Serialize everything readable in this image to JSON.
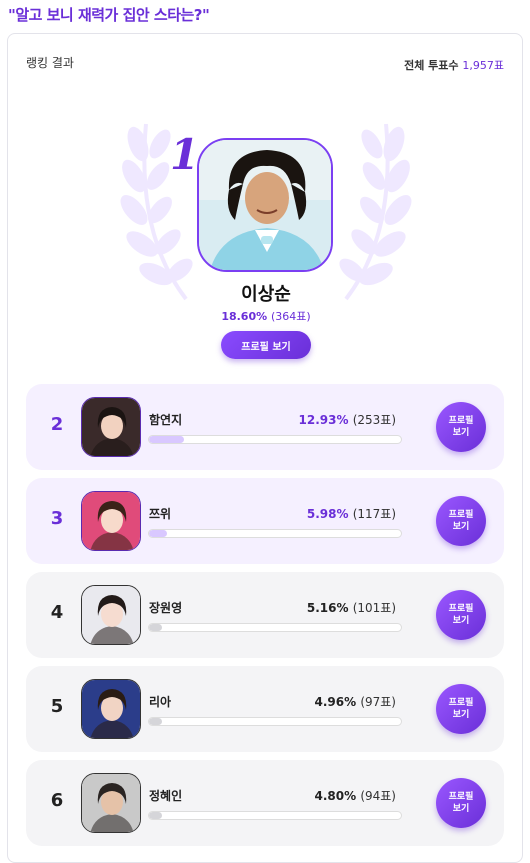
{
  "heading": "\"알고 보니 재력가 집안 스타는?\"",
  "card": {
    "title": "랭킹 결과",
    "total_label": "전체 투표수",
    "total_value": "1,957표"
  },
  "winner": {
    "rank": "1",
    "name": "이상순",
    "percent": "18.60%",
    "votes": "(364표)",
    "button_label": "프로필 보기"
  },
  "rows": [
    {
      "rank": "2",
      "name": "함연지",
      "percent": "12.93%",
      "votes": "(253표)",
      "fraction": 0.14,
      "button_label": "프로필\n보기",
      "highlight": true
    },
    {
      "rank": "3",
      "name": "쯔위",
      "percent": "5.98%",
      "votes": "(117표)",
      "fraction": 0.07,
      "button_label": "프로필\n보기",
      "highlight": true
    },
    {
      "rank": "4",
      "name": "장원영",
      "percent": "5.16%",
      "votes": "(101표)",
      "fraction": 0.05,
      "button_label": "프로필\n보기",
      "highlight": false
    },
    {
      "rank": "5",
      "name": "리아",
      "percent": "4.96%",
      "votes": "(97표)",
      "fraction": 0.05,
      "button_label": "프로필\n보기",
      "highlight": false
    },
    {
      "rank": "6",
      "name": "정혜인",
      "percent": "4.80%",
      "votes": "(94표)",
      "fraction": 0.05,
      "button_label": "프로필\n보기",
      "highlight": false
    }
  ],
  "colors": {
    "accent": "#6a2fd8",
    "row_top_bg": "#f5f0ff",
    "row_plain_bg": "#f4f4f6"
  }
}
